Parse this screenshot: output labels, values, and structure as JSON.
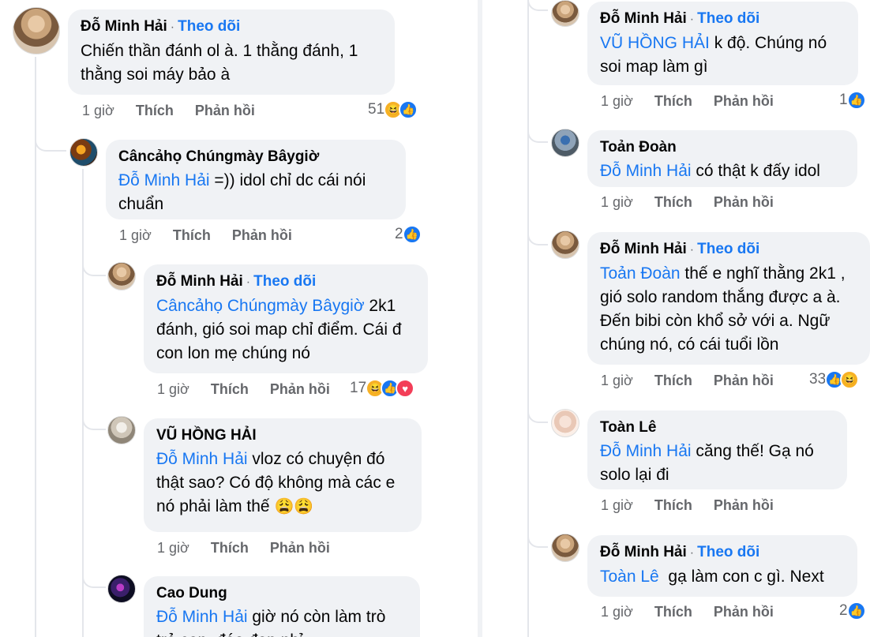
{
  "left": {
    "c1": {
      "name": "Đỗ Minh Hải",
      "follow": "Theo dõi",
      "text": "Chiến thần đánh ol à. 1 thằng đánh, 1 thằng soi máy bảo à",
      "time": "1 giờ",
      "like": "Thích",
      "reply": "Phản hồi",
      "reactions": "51"
    },
    "c2": {
      "name": "Câncảhọ Chúngmày Bâygiờ",
      "mention": "Đỗ Minh Hải",
      "text": " =)) idol chỉ dc cái nói chuẩn",
      "time": "1 giờ",
      "like": "Thích",
      "reply": "Phản hồi",
      "reactions": "2"
    },
    "c3": {
      "name": "Đỗ Minh Hải",
      "follow": "Theo dõi",
      "mention": "Câncảhọ Chúngmày Bâygiờ",
      "text": " 2k1 đánh, gió soi map chỉ điểm. Cái đ con lon mẹ chúng nó",
      "time": "1 giờ",
      "like": "Thích",
      "reply": "Phản hồi",
      "reactions": "17"
    },
    "c4": {
      "name": "VŨ HỒNG HẢI",
      "mention": "Đỗ Minh Hải",
      "text": " vloz có chuyện đó thật sao? Có độ không mà các e nó phải làm thế ",
      "emoji": "😩😩",
      "time": "1 giờ",
      "like": "Thích",
      "reply": "Phản hồi"
    },
    "c5": {
      "name": "Cao Dung",
      "mention": "Đỗ Minh Hải",
      "text": " giờ nó còn làm trò trẻ con, đéo đẹp nhỉ"
    }
  },
  "right": {
    "c1": {
      "name": "Đỗ Minh Hải",
      "follow": "Theo dõi",
      "mention": "VŨ HỒNG HẢI",
      "text": " k độ. Chúng nó soi map làm gì",
      "time": "1 giờ",
      "like": "Thích",
      "reply": "Phản hồi",
      "reactions": "1"
    },
    "c2": {
      "name": "Toản Đoàn",
      "mention": "Đỗ Minh Hải",
      "text": " có thật k đấy idol",
      "time": "1 giờ",
      "like": "Thích",
      "reply": "Phản hồi"
    },
    "c3": {
      "name": "Đỗ Minh Hải",
      "follow": "Theo dõi",
      "mention": "Toản Đoàn",
      "text": " thế e nghĩ thằng 2k1 , gió solo random thắng được a à. Đến bibi còn khổ sở với a. Ngữ chúng nó, có cái tuổi lồn",
      "time": "1 giờ",
      "like": "Thích",
      "reply": "Phản hồi",
      "reactions": "33"
    },
    "c4": {
      "name": "Toàn Lê",
      "mention": "Đỗ Minh Hải",
      "text": " căng thế! Gạ nó solo lại đi",
      "time": "1 giờ",
      "like": "Thích",
      "reply": "Phản hồi"
    },
    "c5": {
      "name": "Đỗ Minh Hải",
      "follow": "Theo dõi",
      "mention": "Toàn Lê",
      "text": "  gạ làm con c gì. Next",
      "time": "1 giờ",
      "like": "Thích",
      "reply": "Phản hồi",
      "reactions": "2"
    }
  },
  "separator": "·",
  "icons": {
    "like": "like-icon",
    "haha": "haha-icon",
    "love": "love-icon"
  },
  "colors": {
    "link": "#1877f2",
    "bubble": "#f0f2f5",
    "meta": "#65676b"
  }
}
